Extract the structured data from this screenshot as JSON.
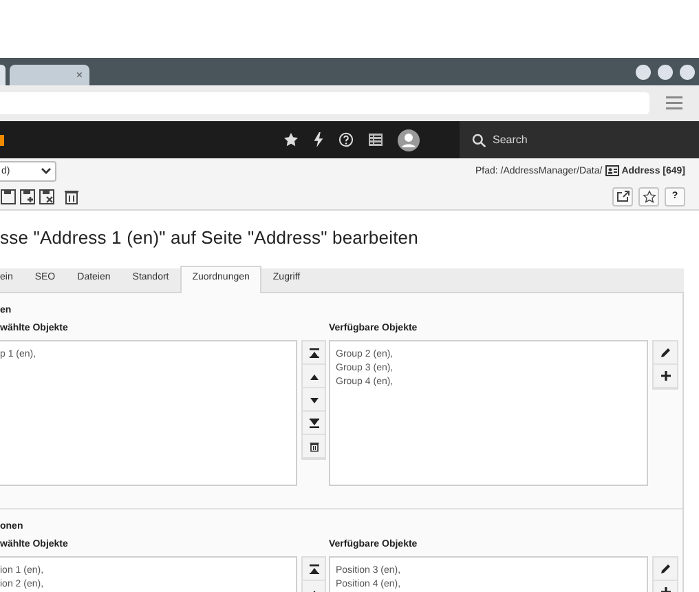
{
  "browser": {
    "tab_close": "×"
  },
  "topbar": {
    "search": {
      "placeholder": "Search"
    }
  },
  "toolbar": {
    "language_select": {
      "value": "d)"
    },
    "path": {
      "prefix": "Pfad: /AddressManager/Data/",
      "page": "Address [649]"
    },
    "help": "?"
  },
  "heading": "sse \"Address 1 (en)\" auf Seite \"Address\" bearbeiten",
  "tabs": [
    {
      "label": "ein",
      "selected": false
    },
    {
      "label": "SEO",
      "selected": false
    },
    {
      "label": "Dateien",
      "selected": false
    },
    {
      "label": "Standort",
      "selected": false
    },
    {
      "label": "Zuordnungen",
      "selected": true
    },
    {
      "label": "Zugriff",
      "selected": false
    }
  ],
  "sections": [
    {
      "title": "en",
      "selected_label": "wählte Objekte",
      "available_label": "Verfügbare Objekte",
      "selected_items": [
        "p 1 (en),"
      ],
      "available_items": [
        "Group 2 (en),",
        "Group 3 (en),",
        "Group 4 (en),"
      ]
    },
    {
      "title": "onen",
      "selected_label": "wählte Objekte",
      "available_label": "Verfügbare Objekte",
      "selected_items": [
        "ion 1 (en),",
        "ion 2 (en),"
      ],
      "available_items": [
        "Position 3 (en),",
        "Position 4 (en),"
      ]
    }
  ]
}
